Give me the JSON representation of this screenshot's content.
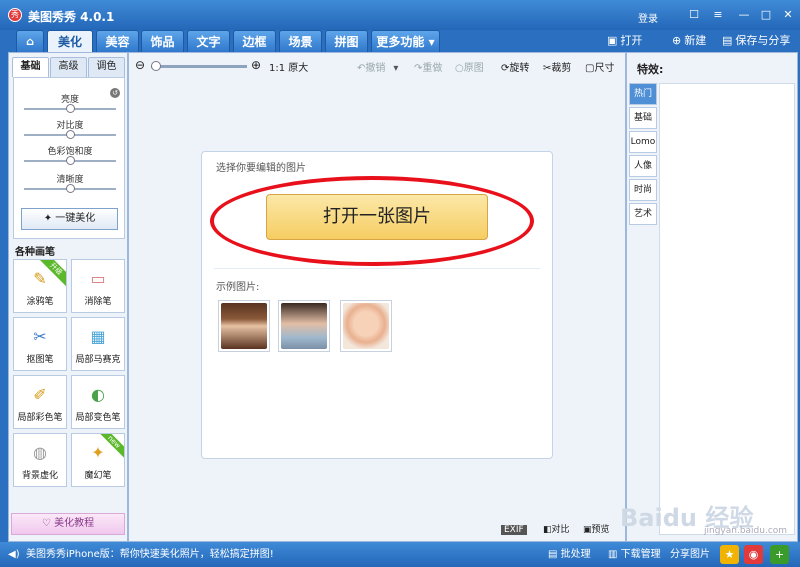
{
  "window": {
    "title": "美图秀秀 4.0.1",
    "logo_glyph": "秀",
    "login": "登录",
    "controls": {
      "msg": "☐",
      "chat": "≡",
      "min": "—",
      "max": "□",
      "close": "✕"
    }
  },
  "tabs": [
    {
      "label": "⌂"
    },
    {
      "label": "美化"
    },
    {
      "label": "美容"
    },
    {
      "label": "饰品"
    },
    {
      "label": "文字"
    },
    {
      "label": "边框"
    },
    {
      "label": "场景"
    },
    {
      "label": "拼图"
    },
    {
      "label": "更多功能 ▾"
    }
  ],
  "actions": {
    "open": "打开",
    "new": "新建",
    "save": "保存与分享"
  },
  "left": {
    "subtabs": [
      "基础",
      "高级",
      "调色"
    ],
    "sliders": [
      {
        "label": "亮度",
        "value": 0.5
      },
      {
        "label": "对比度",
        "value": 0.5
      },
      {
        "label": "色彩饱和度",
        "value": 0.5
      },
      {
        "label": "清晰度",
        "value": 0.5
      }
    ],
    "one_key": "一键美化",
    "pens_title": "各种画笔",
    "pens": [
      {
        "label": "涂鸦笔",
        "icon": "✎",
        "badge": "升级"
      },
      {
        "label": "消除笔",
        "icon": "▭"
      },
      {
        "label": "抠图笔",
        "icon": "✂"
      },
      {
        "label": "局部马赛克",
        "icon": "▦"
      },
      {
        "label": "局部彩色笔",
        "icon": "✐"
      },
      {
        "label": "局部变色笔",
        "icon": "◐"
      },
      {
        "label": "背景虚化",
        "icon": "◍"
      },
      {
        "label": "魔幻笔",
        "icon": "✦",
        "badge": "new"
      }
    ],
    "tutorial": "美化教程"
  },
  "toolbar": {
    "zoom_icon": "⊖",
    "zoom_in": "⊕",
    "zoom_level": 0,
    "orig": "1:1 原大",
    "undo": "撤销",
    "undo_arrow": "▾",
    "redo": "重做",
    "original": "原图",
    "rotate": "旋转",
    "crop": "裁剪",
    "resize": "尺寸"
  },
  "card": {
    "hint": "选择你要编辑的图片",
    "open_button": "打开一张图片",
    "examples_label": "示例图片:"
  },
  "bottom": {
    "exif": "EXIF",
    "compare": "对比",
    "preview": "预览"
  },
  "effects": {
    "title": "特效:",
    "categories": [
      "热门",
      "基础",
      "Lomo",
      "人像",
      "时尚",
      "艺术"
    ]
  },
  "watermark": {
    "text": "Baidu 经验",
    "sub": "jingyan.baidu.com"
  },
  "status": {
    "info": "美图秀秀iPhone版：帮你快速美化照片，轻松搞定拼图!",
    "batch": "批处理",
    "download": "下载管理",
    "share": "分享图片"
  },
  "colors": {
    "accent": "#2a6fc0",
    "annotation": "#e8101a",
    "open_btn": "#f6cd62"
  }
}
